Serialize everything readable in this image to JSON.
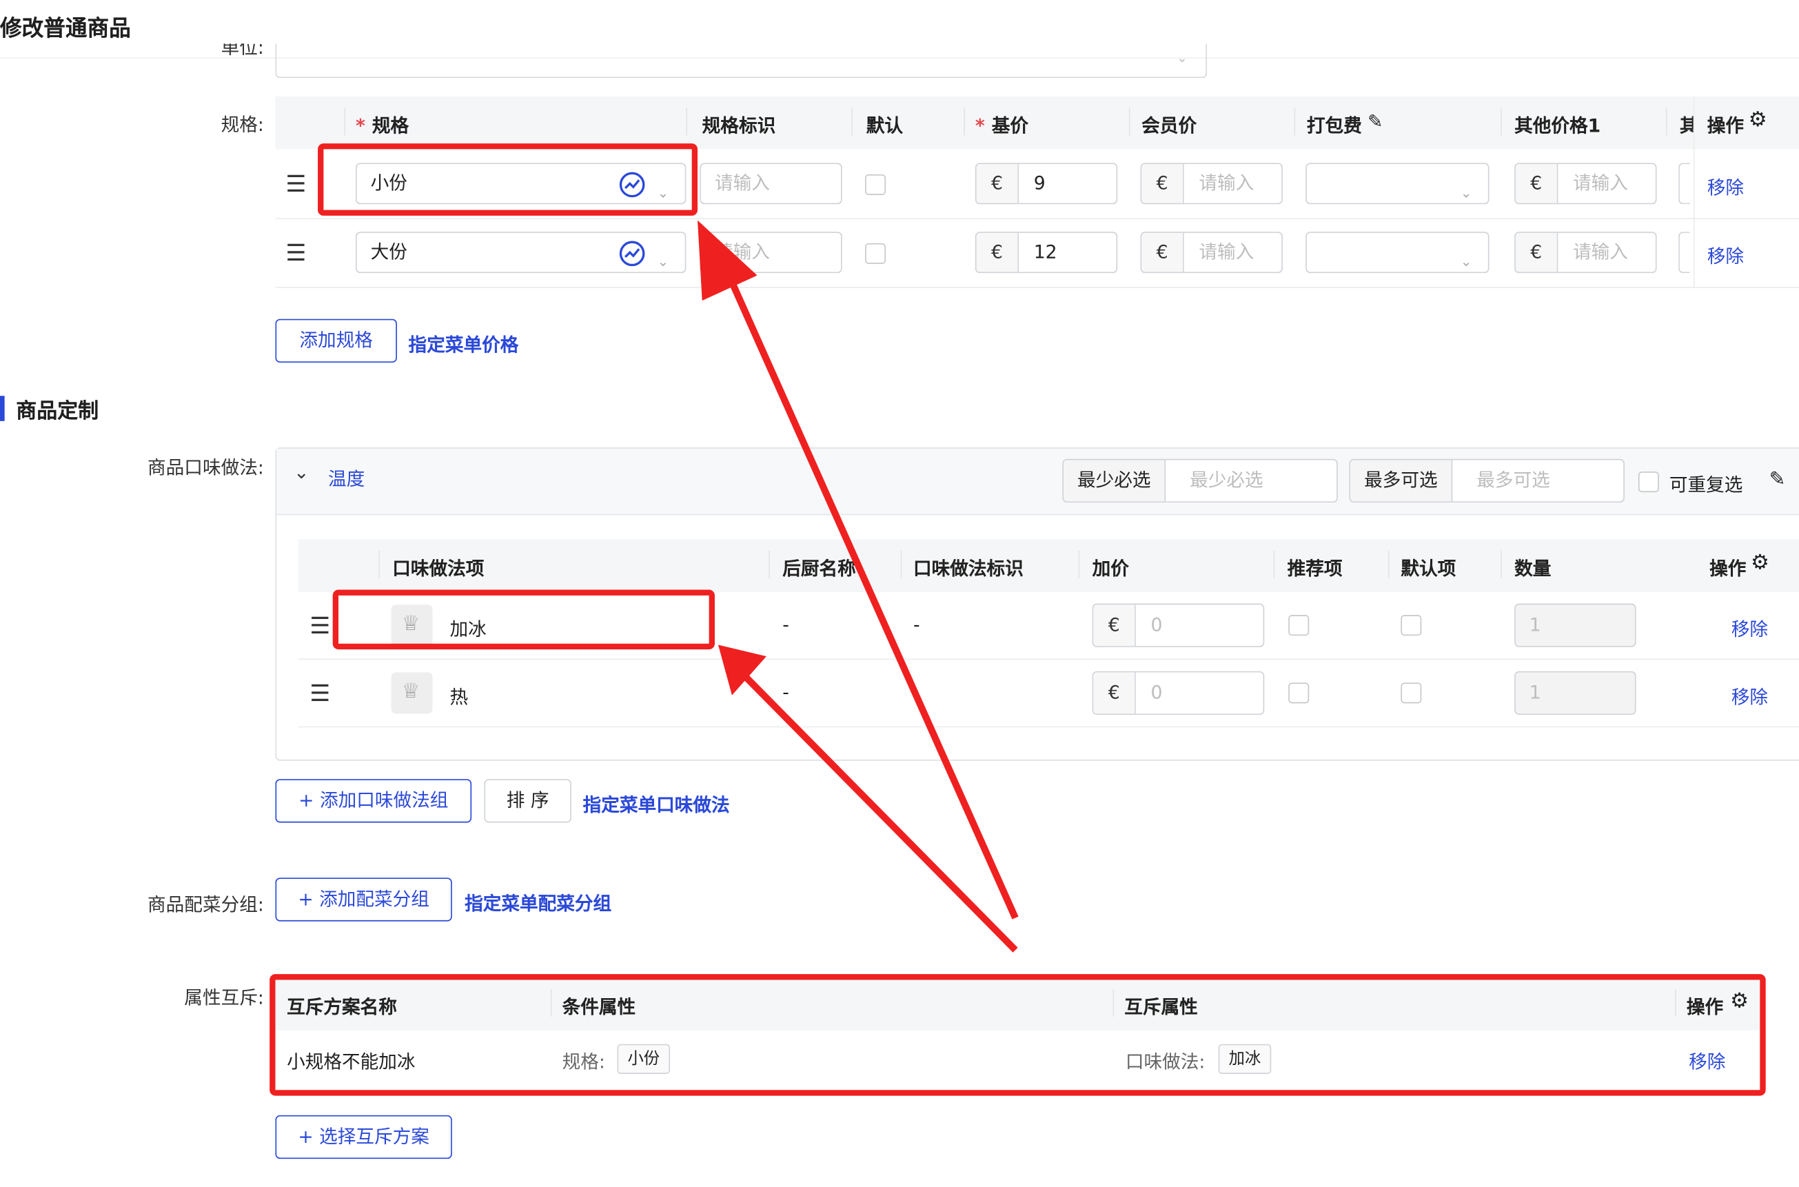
{
  "page_title": "修改普通商品",
  "unit_label": "单位:",
  "spec": {
    "label": "规格:",
    "columns": [
      "规格",
      "规格标识",
      "默认",
      "基价",
      "会员价",
      "打包费",
      "其他价格1",
      "其",
      "操作"
    ],
    "currency": "€",
    "placeholder": "请输入",
    "rows": [
      {
        "name": "小份",
        "base_price": "9",
        "remove": "移除"
      },
      {
        "name": "大份",
        "base_price": "12",
        "remove": "移除"
      }
    ],
    "add_button": "添加规格",
    "menu_price_link": "指定菜单价格"
  },
  "customization": {
    "section_title": "商品定制",
    "flavor_label": "商品口味做法:",
    "group": {
      "name": "温度",
      "min_label": "最少必选",
      "min_placeholder": "最少必选",
      "max_label": "最多可选",
      "max_placeholder": "最多可选",
      "repeat_label": "可重复选"
    },
    "columns": [
      "口味做法项",
      "后厨名称",
      "口味做法标识",
      "加价",
      "推荐项",
      "默认项",
      "数量",
      "操作"
    ],
    "currency": "€",
    "rows": [
      {
        "name": "加冰",
        "kitchen": "-",
        "code": "-",
        "price_placeholder": "0",
        "qty": "1",
        "remove": "移除"
      },
      {
        "name": "热",
        "kitchen": "-",
        "code": "",
        "price_placeholder": "0",
        "qty": "1",
        "remove": "移除"
      }
    ],
    "add_group_button": "+ 添加口味做法组",
    "sort_button": "排 序",
    "menu_flavor_link": "指定菜单口味做法",
    "side_label": "商品配菜分组:",
    "add_side_button": "+ 添加配菜分组",
    "menu_side_link": "指定菜单配菜分组"
  },
  "mutex": {
    "label": "属性互斥:",
    "columns": [
      "互斥方案名称",
      "条件属性",
      "互斥属性",
      "操作"
    ],
    "row": {
      "name": "小规格不能加冰",
      "cond_label": "规格:",
      "cond_tag": "小份",
      "mutex_label": "口味做法:",
      "mutex_tag": "加冰",
      "remove": "移除"
    },
    "select_button": "+ 选择互斥方案"
  },
  "colors": {
    "accent": "#2b49d8",
    "annotation": "#ef2020",
    "required": "#e5484d"
  },
  "icons": [
    "drag-handle-icon",
    "chevron-down-icon",
    "translate-icon",
    "edit-icon",
    "gear-icon",
    "chef-hat-icon"
  ]
}
